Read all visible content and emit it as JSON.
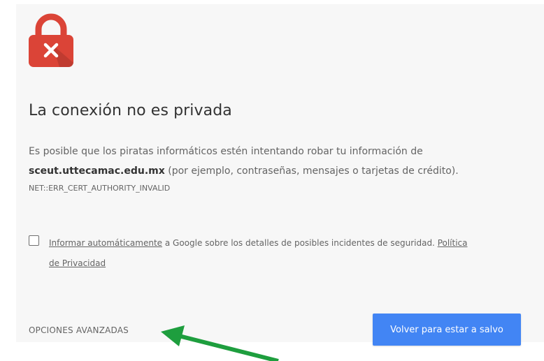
{
  "interstitial": {
    "title": "La conexión no es privada",
    "desc_part1": "Es posible que los piratas informáticos estén intentando robar tu información de",
    "domain": "sceut.uttecamac.edu.mx",
    "desc_part2": " (por ejemplo, contraseñas, mensajes o tarjetas de crédito).",
    "error_code": "NET::ERR_CERT_AUTHORITY_INVALID",
    "report_link": "Informar automáticamente",
    "report_text": " a Google sobre los detalles de posibles incidentes de seguridad. ",
    "privacy_link_1": "Política",
    "privacy_link_2": "de Privacidad",
    "advanced_label": "OPCIONES AVANZADAS",
    "back_button_label": "Volver para estar a salvo"
  },
  "colors": {
    "lock": "#db4437",
    "primary_button": "#4285f4",
    "arrow": "#1e9e3e",
    "background": "#f7f7f7"
  },
  "icons": {
    "lock": "lock-icon",
    "arrow": "arrow-annotation"
  }
}
